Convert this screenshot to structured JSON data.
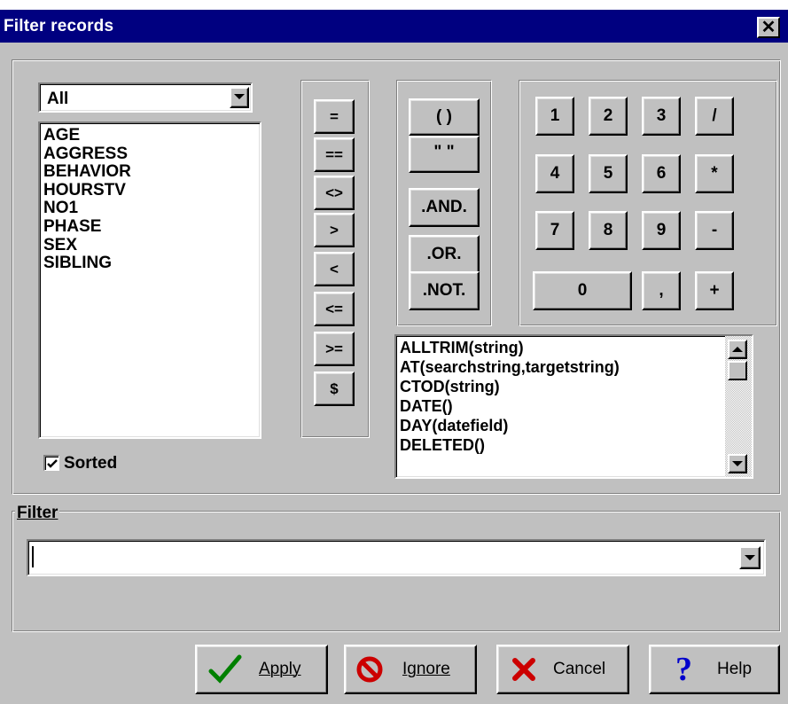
{
  "window": {
    "title": "Filter records",
    "close_glyph": "✕"
  },
  "fields": {
    "dropdown_value": "All",
    "items": [
      "AGE",
      "AGGRESS",
      "BEHAVIOR",
      "HOURSTV",
      "NO1",
      "PHASE",
      "SEX",
      "SIBLING"
    ],
    "sorted_label": "Sorted",
    "sorted_checked": true
  },
  "operators": [
    "=",
    "==",
    "<>",
    ">",
    "<",
    "<=",
    ">=",
    "$"
  ],
  "grouping": {
    "parens": "(  )",
    "quotes": "\"   \"",
    "and": ".AND.",
    "or": ".OR.",
    "not": ".NOT."
  },
  "keypad": {
    "row1": [
      "1",
      "2",
      "3",
      "/"
    ],
    "row2": [
      "4",
      "5",
      "6",
      "*"
    ],
    "row3": [
      "7",
      "8",
      "9",
      "-"
    ],
    "row4": [
      "0",
      ",",
      "+"
    ]
  },
  "functions": [
    "ALLTRIM(string)",
    "AT(searchstring,targetstring)",
    "CTOD(string)",
    "DATE()",
    "DAY(datefield)",
    "DELETED()"
  ],
  "filter": {
    "label": "Filter",
    "value": ""
  },
  "buttons": {
    "apply": "Apply",
    "ignore": "Ignore",
    "cancel": "Cancel",
    "help": "Help"
  },
  "colors": {
    "titlebar": "#000080",
    "face": "#c0c0c0",
    "apply_icon": "#008000",
    "ignore_icon": "#cc0000",
    "cancel_icon": "#cc0000",
    "help_icon": "#0000cc"
  }
}
